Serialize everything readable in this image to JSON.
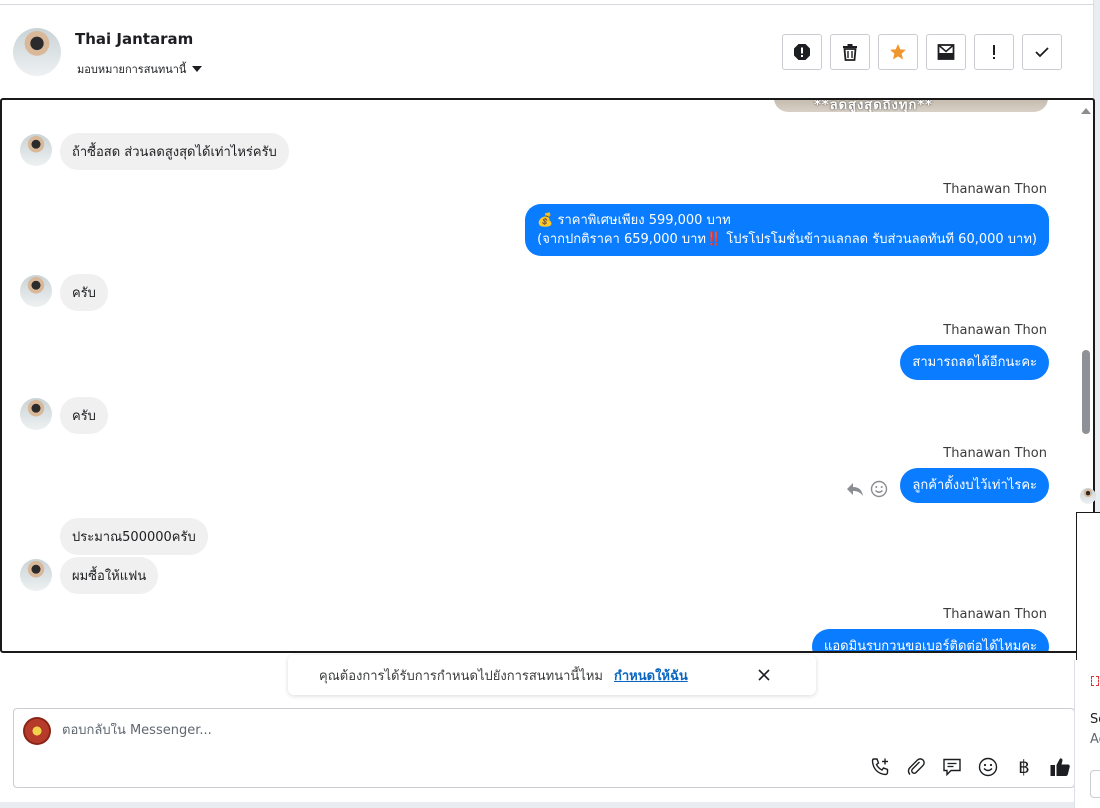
{
  "header": {
    "contact_name": "Thai Jantaram",
    "assign_label": "มอบหมายการสนทนานี้",
    "tools": [
      "report-icon",
      "trash-icon",
      "star-icon",
      "mark-unread-icon",
      "exclamation-icon",
      "check-icon"
    ]
  },
  "conversation": {
    "peek_text": "**ลดสูงสุดถึงทุก**",
    "messages": [
      {
        "dir": "in",
        "text": "ถ้าซื้อสด  ส่วนลดสูงสุดได้เท่าไหร่ครับ"
      },
      {
        "dir": "out",
        "sender": "Thanawan Thon",
        "line1": "💰 ราคาพิเศษเพียง 599,000 บาท",
        "line2": "(จากปกติราคา 659,000 บาท‼️ โปรโปรโมชั่นข้าวแลกลด รับส่วนลดทันที 60,000 บาท)"
      },
      {
        "dir": "in",
        "text": "ครับ"
      },
      {
        "dir": "out",
        "sender": "Thanawan Thon",
        "text": "สามารถลดได้อีกนะคะ"
      },
      {
        "dir": "in",
        "text": "ครับ"
      },
      {
        "dir": "out",
        "sender": "Thanawan Thon",
        "text": "ลูกค้าตั้งงบไว้เท่าไรคะ"
      },
      {
        "dir": "in",
        "text": "ประมาณ500000ครับ"
      },
      {
        "dir": "in",
        "text": "ผมซื้อให้แฟน"
      },
      {
        "dir": "out",
        "sender": "Thanawan Thon",
        "text": "แอดมินรบกวนขอเบอร์ติดต่อได้ไหมคะ"
      }
    ]
  },
  "banner": {
    "text": "คุณต้องการได้รับการกำหนดไปยังการสนทนานี้ไหม",
    "link": "กำหนดให้ฉัน"
  },
  "composer": {
    "placeholder": "ตอบกลับใน Messenger...",
    "tools": [
      "call-add-icon",
      "paperclip-icon",
      "chat-bubbles-icon",
      "emoji-icon",
      "baht-icon",
      "thumbs-up-icon"
    ],
    "baht_symbol": "฿"
  },
  "edge_card": {
    "line1": "So",
    "line2": "Ad"
  },
  "colors": {
    "outgoing_bubble": "#0a7cff",
    "incoming_bubble": "#f0f0f0",
    "star": "#f0962e",
    "link": "#0a66c2"
  }
}
